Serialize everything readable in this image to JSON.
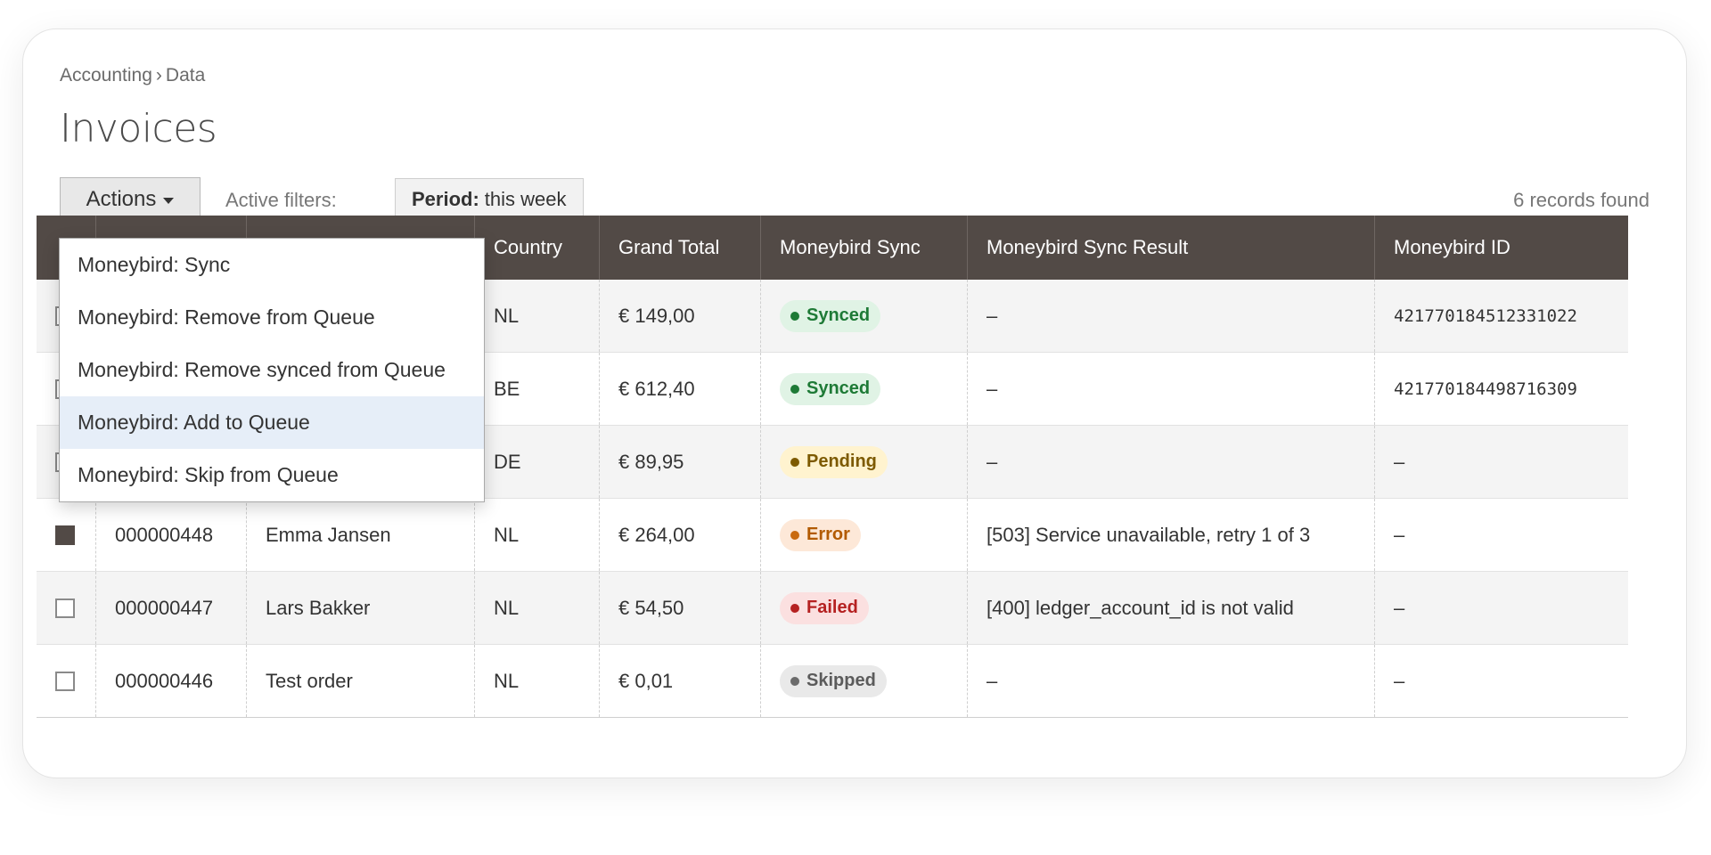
{
  "breadcrumb": {
    "part1": "Accounting",
    "sep": "›",
    "part2": "Data"
  },
  "page_title": "Invoices",
  "toolbar": {
    "actions_label": "Actions",
    "filters_label": "Active filters:",
    "filter_key": "Period:",
    "filter_value": "this week",
    "records_text": "6 records found"
  },
  "dropdown": {
    "items": [
      "Moneybird: Sync",
      "Moneybird: Remove from Queue",
      "Moneybird: Remove synced from Queue",
      "Moneybird: Add to Queue",
      "Moneybird: Skip from Queue"
    ],
    "highlighted": "Moneybird: Add to Queue"
  },
  "table": {
    "headers": [
      "",
      "",
      "",
      "Country",
      "Grand Total",
      "Moneybird Sync",
      "Moneybird Sync Result",
      "Moneybird ID"
    ],
    "rows": [
      {
        "checked": false,
        "number": "",
        "customer": "",
        "country": "NL",
        "total": "€ 149,00",
        "sync": "Synced",
        "result": "–",
        "moneybird_id": "421770184512331022"
      },
      {
        "checked": false,
        "number": "",
        "customer": "",
        "country": "BE",
        "total": "€ 612,40",
        "sync": "Synced",
        "result": "–",
        "moneybird_id": "421770184498716309"
      },
      {
        "checked": false,
        "number": "",
        "customer": "",
        "country": "DE",
        "total": "€ 89,95",
        "sync": "Pending",
        "result": "–",
        "moneybird_id": "–"
      },
      {
        "checked": true,
        "number": "000000448",
        "customer": "Emma Jansen",
        "country": "NL",
        "total": "€ 264,00",
        "sync": "Error",
        "result": "[503] Service unavailable, retry 1 of 3",
        "moneybird_id": "–"
      },
      {
        "checked": false,
        "number": "000000447",
        "customer": "Lars Bakker",
        "country": "NL",
        "total": "€ 54,50",
        "sync": "Failed",
        "result": "[400] ledger_account_id is not valid",
        "moneybird_id": "–"
      },
      {
        "checked": false,
        "number": "000000446",
        "customer": "Test order",
        "country": "NL",
        "total": "€ 0,01",
        "sync": "Skipped",
        "result": "–",
        "moneybird_id": "–"
      }
    ]
  },
  "colors": {
    "header_bg": "#524a46",
    "synced": "#1e7a36",
    "pending": "#7d5a00",
    "error": "#c96a10",
    "failed": "#b52121",
    "skipped": "#6b6b6b",
    "highlight": "#e6eef8"
  }
}
